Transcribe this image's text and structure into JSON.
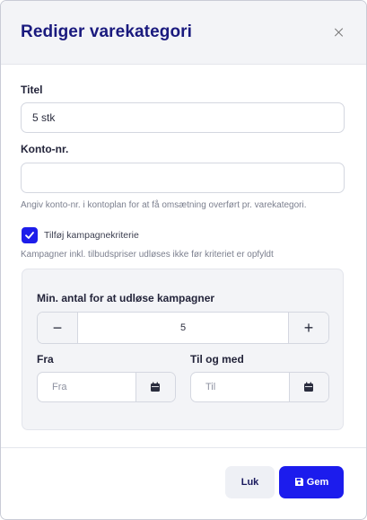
{
  "modal": {
    "title": "Rediger varekategori"
  },
  "form": {
    "title_label": "Titel",
    "title_value": "5 stk",
    "account_label": "Konto-nr.",
    "account_value": "",
    "account_hint": "Angiv konto-nr. i kontoplan for at få omsætning overført pr. varekategori.",
    "campaign_checkbox_label": "Tilføj kampagnekriterie",
    "campaign_checkbox_checked": true,
    "campaign_hint": "Kampagner inkl. tilbudspriser udløses ikke før kriteriet er opfyldt"
  },
  "campaign": {
    "min_label": "Min. antal for at udløse kampagner",
    "min_value": "5",
    "minus": "−",
    "plus": "+",
    "from_label": "Fra",
    "from_placeholder": "Fra",
    "to_label": "Til og med",
    "to_placeholder": "Til"
  },
  "footer": {
    "close_label": "Luk",
    "save_label": "Gem"
  },
  "colors": {
    "primary": "#1c1ced",
    "title": "#1a1a7e"
  }
}
